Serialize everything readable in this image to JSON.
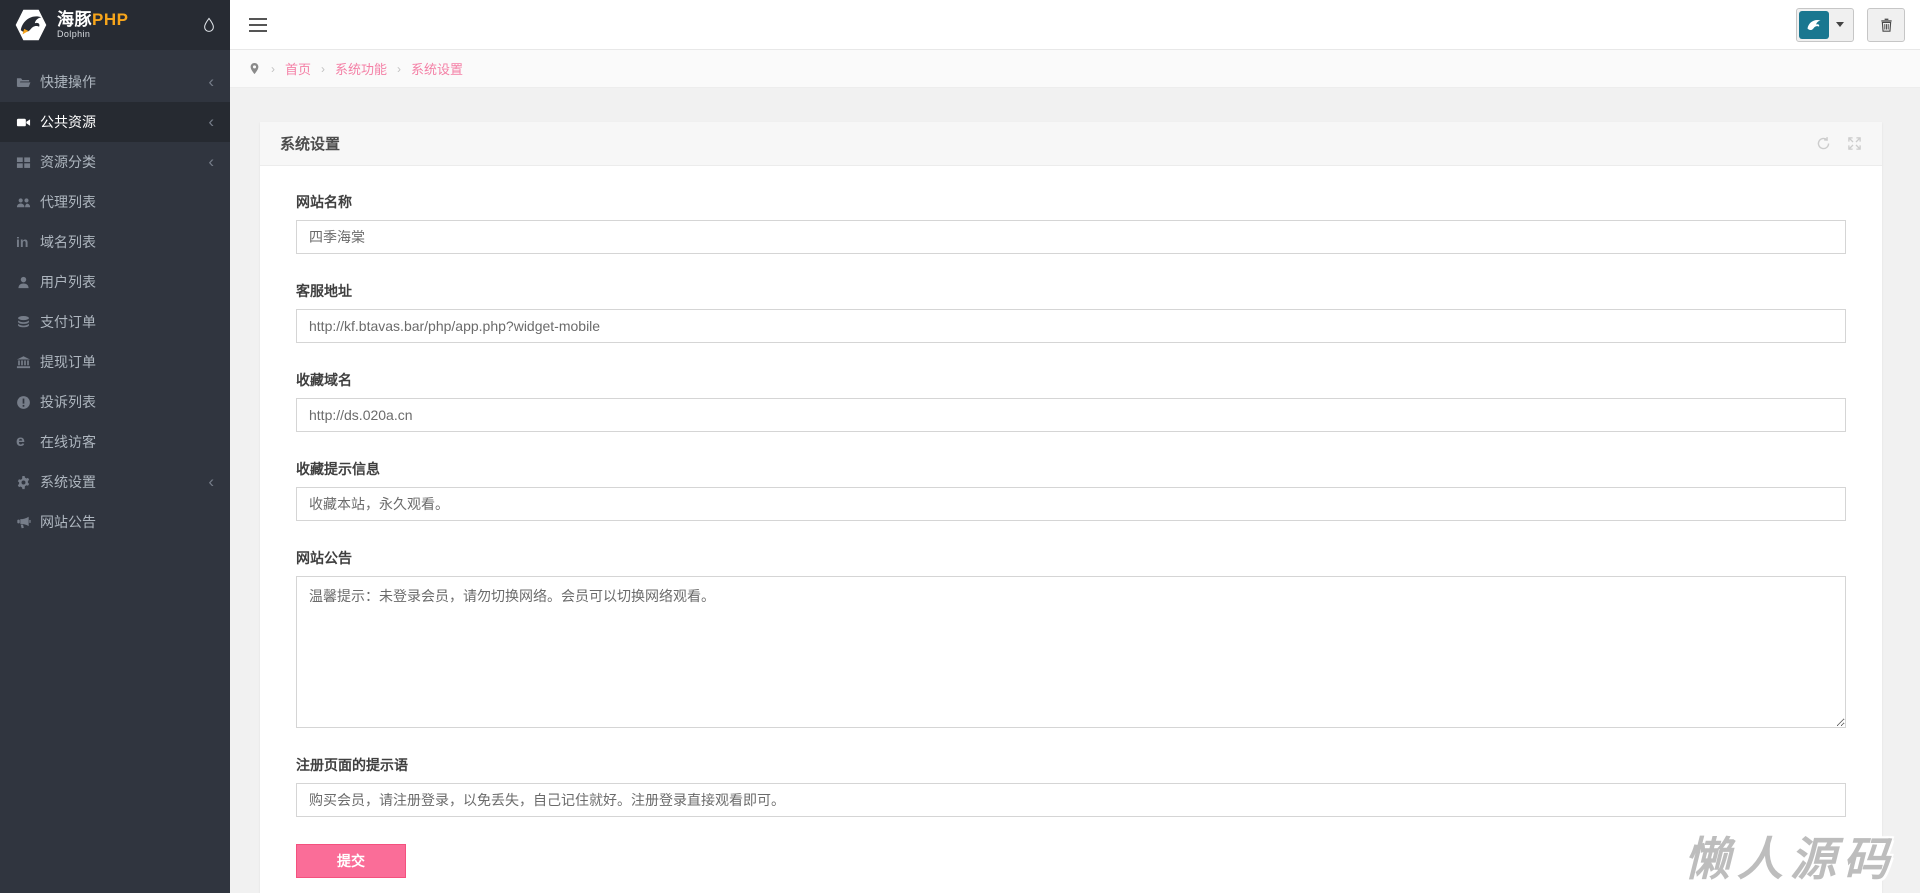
{
  "brand": {
    "name_cn": "海豚",
    "name_php": "PHP",
    "subtitle": "Dolphin"
  },
  "sidebar": {
    "items": [
      {
        "label": "快捷操作",
        "icon": "folder-open",
        "active": false,
        "has_arrow": true
      },
      {
        "label": "公共资源",
        "icon": "video-camera",
        "active": true,
        "has_arrow": true
      },
      {
        "label": "资源分类",
        "icon": "grid",
        "active": false,
        "has_arrow": true
      },
      {
        "label": "代理列表",
        "icon": "users",
        "active": false,
        "has_arrow": false
      },
      {
        "label": "域名列表",
        "icon": "linkedin",
        "active": false,
        "has_arrow": false
      },
      {
        "label": "用户列表",
        "icon": "user",
        "active": false,
        "has_arrow": false
      },
      {
        "label": "支付订单",
        "icon": "database",
        "active": false,
        "has_arrow": false
      },
      {
        "label": "提现订单",
        "icon": "bank",
        "active": false,
        "has_arrow": false
      },
      {
        "label": "投诉列表",
        "icon": "exclamation-circle",
        "active": false,
        "has_arrow": false
      },
      {
        "label": "在线访客",
        "icon": "edge",
        "active": false,
        "has_arrow": false
      },
      {
        "label": "系统设置",
        "icon": "gear",
        "active": false,
        "has_arrow": true
      },
      {
        "label": "网站公告",
        "icon": "bullhorn",
        "active": false,
        "has_arrow": false
      }
    ],
    "arrow_glyph": "‹",
    "linkedin_glyph": "in",
    "edge_glyph": "e"
  },
  "breadcrumb": {
    "items": [
      "首页",
      "系统功能",
      "系统设置"
    ],
    "separator": "›"
  },
  "card": {
    "title": "系统设置"
  },
  "form": {
    "fields": [
      {
        "label": "网站名称",
        "value": "四季海棠"
      },
      {
        "label": "客服地址",
        "value": "http://kf.btavas.bar/php/app.php?widget-mobile"
      },
      {
        "label": "收藏域名",
        "value": "http://ds.020a.cn"
      },
      {
        "label": "收藏提示信息",
        "value": "收藏本站，永久观看。"
      },
      {
        "label": "网站公告",
        "value": "温馨提示：未登录会员，请勿切换网络。会员可以切换网络观看。"
      },
      {
        "label": "注册页面的提示语",
        "value": "购买会员，请注册登录，以免丢失，自己记住就好。注册登录直接观看即可。"
      }
    ],
    "submit_label": "提交"
  },
  "watermark": "懒人源码",
  "colors": {
    "sidebar_bg": "#30353f",
    "sidebar_logo_bg": "#272b33",
    "sidebar_active_bg": "#262a31",
    "brand_orange": "#f7a51b",
    "link_pink": "#f480a6",
    "button_pink": "#fa6d98",
    "avatar_teal": "#1a7790",
    "content_bg": "#f1f1f1"
  }
}
